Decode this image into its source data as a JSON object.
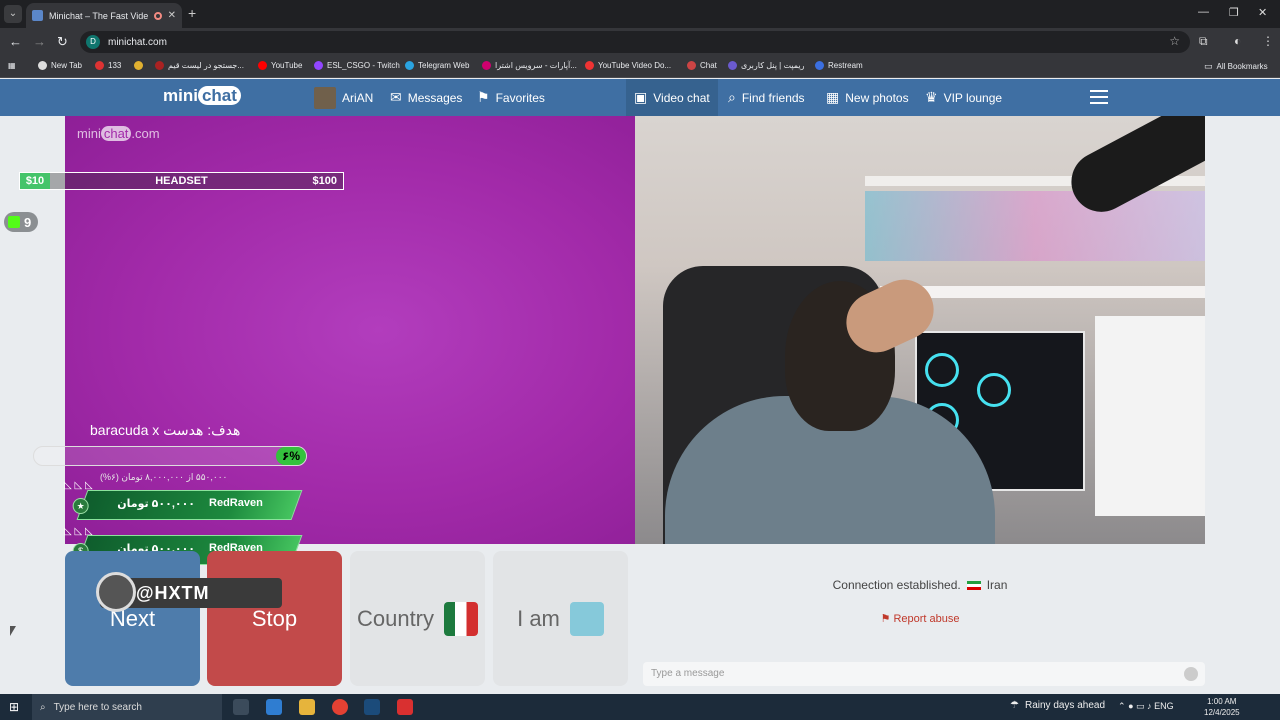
{
  "browser": {
    "tab_title": "Minichat – The Fast Video C",
    "address": "minichat.com",
    "bookmarks": [
      "New Tab",
      "133",
      "جستجو در لیست قیم...",
      "YouTube",
      "ESL_CSGO - Twitch",
      "Telegram Web",
      "آپارات - سرویس اشترا...",
      "YouTube Video Do...",
      "Chat",
      "ریمپت | پنل کاربری",
      "Restream",
      "All Bookmarks"
    ]
  },
  "site": {
    "logo_mini": "mini",
    "logo_chat": "chat",
    "nav_left": [
      {
        "label": "AriAN",
        "icon": "user-avatar"
      },
      {
        "label": "Messages",
        "icon": "envelope-icon"
      },
      {
        "label": "Favorites",
        "icon": "bookmark-icon"
      }
    ],
    "nav_right": [
      {
        "label": "Video chat",
        "icon": "chat-bubble-icon"
      },
      {
        "label": "Find friends",
        "icon": "search-icon"
      },
      {
        "label": "New photos",
        "icon": "grid-icon"
      },
      {
        "label": "VIP lounge",
        "icon": "crown-icon"
      }
    ],
    "watermark_mini": "mini",
    "watermark_chat": "chat",
    "watermark_com": ".com"
  },
  "overlay": {
    "goal_low": "$10",
    "goal_label": "HEADSET",
    "goal_high": "$100",
    "kick_count": "9",
    "donation_goal_title": "هدف: هدست baracuda x",
    "progress_percent_label": "۶%",
    "progress_fraction": 0.06,
    "progress_sub": "۵۵۰,۰۰۰ از ۸,۰۰۰,۰۰۰ تومان (۶%)",
    "donations": [
      {
        "name": "RedRaven",
        "amount": "۵۰۰,۰۰۰ تومان"
      },
      {
        "name": "RedRaven",
        "amount": "۵۰۰,۰۰۰ تومان"
      }
    ],
    "handle": "@HXTM"
  },
  "controls": {
    "next": "Next",
    "stop": "Stop",
    "country": "Country",
    "iam": "I am"
  },
  "chat": {
    "status": "Connection established.",
    "country": "Iran",
    "report": "Report abuse",
    "placeholder": "Type a message"
  },
  "taskbar": {
    "search_placeholder": "Type here to search",
    "weather": "Rainy days ahead",
    "lang": "ENG",
    "time": "1:00 AM",
    "date": "12/4/2025"
  }
}
